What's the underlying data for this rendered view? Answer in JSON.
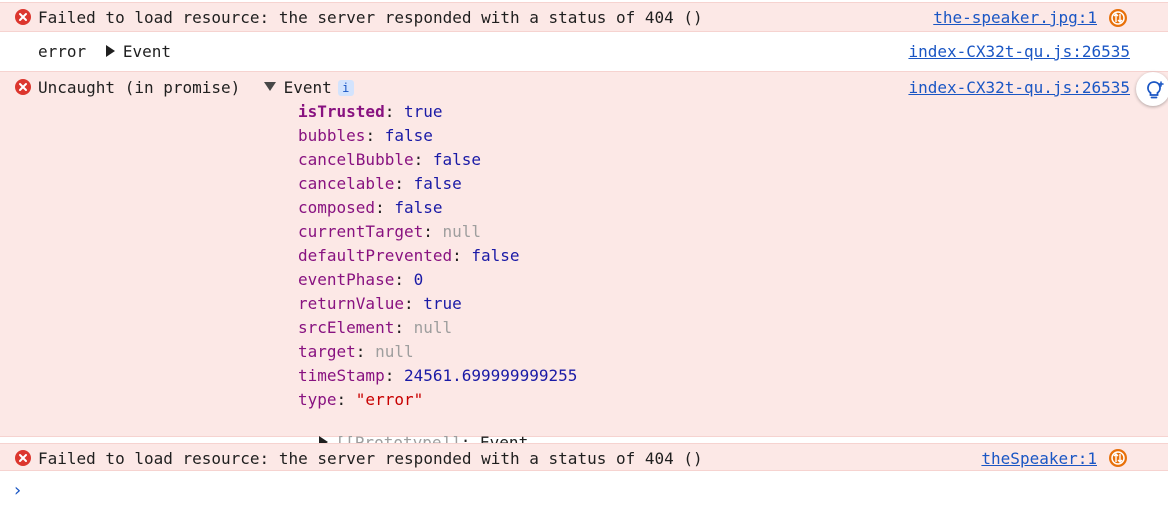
{
  "rows": {
    "error1": {
      "message": "Failed to load resource: the server responded with a status of 404 ()",
      "source": "the-speaker.jpg:1"
    },
    "log": {
      "level": "error",
      "event_label": "Event",
      "source": "index-CX32t-qu.js:26535"
    },
    "uncaught": {
      "message": "Uncaught (in promise)",
      "event_label": "Event",
      "info_badge": "i",
      "source": "index-CX32t-qu.js:26535",
      "properties": [
        {
          "key": "isTrusted",
          "sep": ": ",
          "value": "true",
          "kind": "bool",
          "bold": true
        },
        {
          "key": "bubbles",
          "sep": ": ",
          "value": "false",
          "kind": "bool"
        },
        {
          "key": "cancelBubble",
          "sep": ": ",
          "value": "false",
          "kind": "bool"
        },
        {
          "key": "cancelable",
          "sep": ": ",
          "value": "false",
          "kind": "bool"
        },
        {
          "key": "composed",
          "sep": ": ",
          "value": "false",
          "kind": "bool"
        },
        {
          "key": "currentTarget",
          "sep": ": ",
          "value": "null",
          "kind": "null"
        },
        {
          "key": "defaultPrevented",
          "sep": ": ",
          "value": "false",
          "kind": "bool"
        },
        {
          "key": "eventPhase",
          "sep": ": ",
          "value": "0",
          "kind": "num"
        },
        {
          "key": "returnValue",
          "sep": ": ",
          "value": "true",
          "kind": "bool"
        },
        {
          "key": "srcElement",
          "sep": ": ",
          "value": "null",
          "kind": "null"
        },
        {
          "key": "target",
          "sep": ": ",
          "value": "null",
          "kind": "null"
        },
        {
          "key": "timeStamp",
          "sep": ": ",
          "value": "24561.699999999255",
          "kind": "num"
        },
        {
          "key": "type",
          "sep": ": ",
          "value": "\"error\"",
          "kind": "str"
        }
      ],
      "prototype": {
        "key": "[[Prototype]]",
        "sep": ": ",
        "value": "Event"
      }
    },
    "error2": {
      "message": "Failed to load resource: the server responded with a status of 404 ()",
      "source": "theSpeaker:1"
    }
  },
  "prompt_symbol": "›",
  "colors": {
    "error_bg": "#fce8e6",
    "error_icon": "#dc362e",
    "link": "#1a56c4",
    "network_badge": "#e8710a",
    "prop_key": "#881280",
    "prop_value": "#1a1aa6",
    "null_value": "#9e9e9e",
    "string_value": "#c80000"
  },
  "icons": {
    "error": "error-circle-x-icon",
    "network": "network-request-icon",
    "insight": "ai-insight-lightbulb-icon"
  }
}
